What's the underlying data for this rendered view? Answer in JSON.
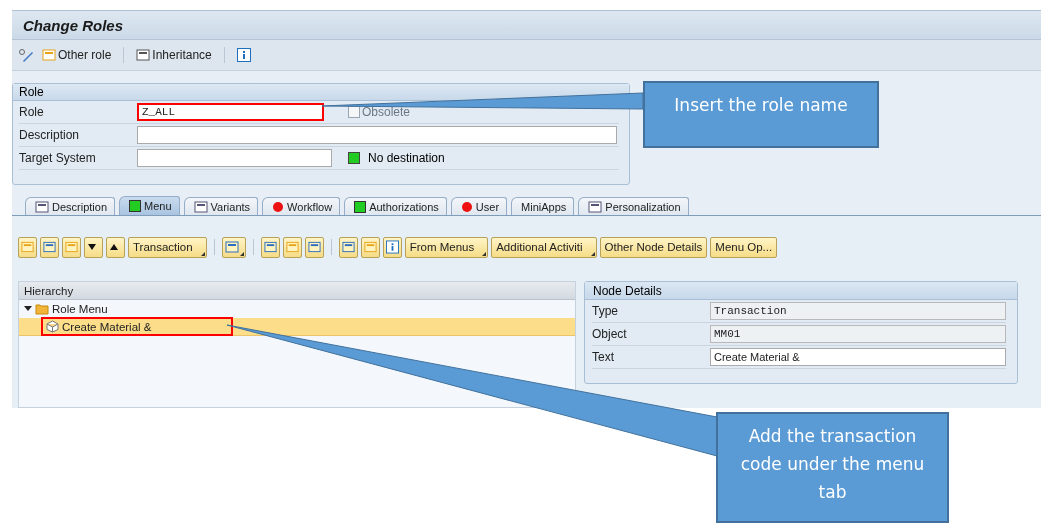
{
  "window": {
    "title": "Change Roles"
  },
  "toolbar": [
    {
      "kind": "icon"
    },
    {
      "kind": "button",
      "label": "Other role"
    },
    {
      "kind": "separator"
    },
    {
      "kind": "button",
      "label": "Inheritance"
    },
    {
      "kind": "separator"
    },
    {
      "kind": "info"
    }
  ],
  "role_group": {
    "title": "Role",
    "fields": [
      {
        "label": "Role",
        "value": "Z_ALL",
        "kind": "short",
        "highlighted": true,
        "checkbox": {
          "label": "Obsolete",
          "checked": false,
          "disabled": true
        }
      },
      {
        "label": "Description",
        "kind": "long",
        "highlighted": false
      },
      {
        "label": "Target System",
        "kind": "short",
        "highlighted": false,
        "status": {
          "color": "#22cc22",
          "label": "No destination"
        }
      }
    ]
  },
  "tabs": [
    {
      "label": "Description",
      "kind": "icon",
      "selected": false
    },
    {
      "label": "Menu",
      "kind": "status",
      "color": "#22cc22",
      "selected": true
    },
    {
      "label": "Variants",
      "kind": "icon",
      "selected": false
    },
    {
      "label": "Workflow",
      "kind": "status",
      "color": "#ee1111",
      "selected": false
    },
    {
      "label": "Authorizations",
      "kind": "status",
      "color": "#22cc22",
      "selected": false
    },
    {
      "label": "User",
      "kind": "status",
      "color": "#ee1111",
      "selected": false
    },
    {
      "label": "MiniApps",
      "kind": "plain",
      "selected": false
    },
    {
      "label": "Personalization",
      "kind": "icon",
      "selected": false
    }
  ],
  "menu_toolbar": [
    {
      "kind": "icon",
      "dropdown": false
    },
    {
      "kind": "icon",
      "dropdown": false
    },
    {
      "kind": "icon",
      "dropdown": false
    },
    {
      "kind": "down",
      "dropdown": false
    },
    {
      "kind": "up",
      "dropdown": false
    },
    {
      "kind": "button",
      "label": "Transaction",
      "dropdown": true
    },
    {
      "kind": "separator"
    },
    {
      "kind": "icon",
      "dropdown": true
    },
    {
      "kind": "separator"
    },
    {
      "kind": "icon",
      "dropdown": false
    },
    {
      "kind": "icon",
      "dropdown": false
    },
    {
      "kind": "icon",
      "dropdown": false
    },
    {
      "kind": "separator"
    },
    {
      "kind": "icon",
      "dropdown": false
    },
    {
      "kind": "icon",
      "dropdown": false
    },
    {
      "kind": "info",
      "dropdown": false
    },
    {
      "kind": "button",
      "label": "From Menus",
      "dropdown": true
    },
    {
      "kind": "button",
      "label": "Additional Activiti",
      "dropdown": true
    },
    {
      "kind": "button",
      "label": "Other Node Details",
      "dropdown": false
    },
    {
      "kind": "button",
      "label": "Menu Op...",
      "dropdown": false
    }
  ],
  "hierarchy": {
    "title": "Hierarchy",
    "items": [
      {
        "label": "Role Menu",
        "expanded": true,
        "selected": false,
        "children": [
          {
            "label": "Create Material &",
            "selected": true,
            "highlighted": true
          }
        ]
      }
    ]
  },
  "node_details": {
    "title": "Node Details",
    "fields": [
      {
        "label": "Type",
        "value": "Transaction",
        "readonly": true
      },
      {
        "label": "Object",
        "value": "MM01",
        "readonly": true
      },
      {
        "label": "Text",
        "value": "Create Material &",
        "readonly": false
      }
    ]
  },
  "callouts": [
    {
      "text": "Insert the role name"
    },
    {
      "text": "Add the transaction code under the menu tab"
    }
  ]
}
